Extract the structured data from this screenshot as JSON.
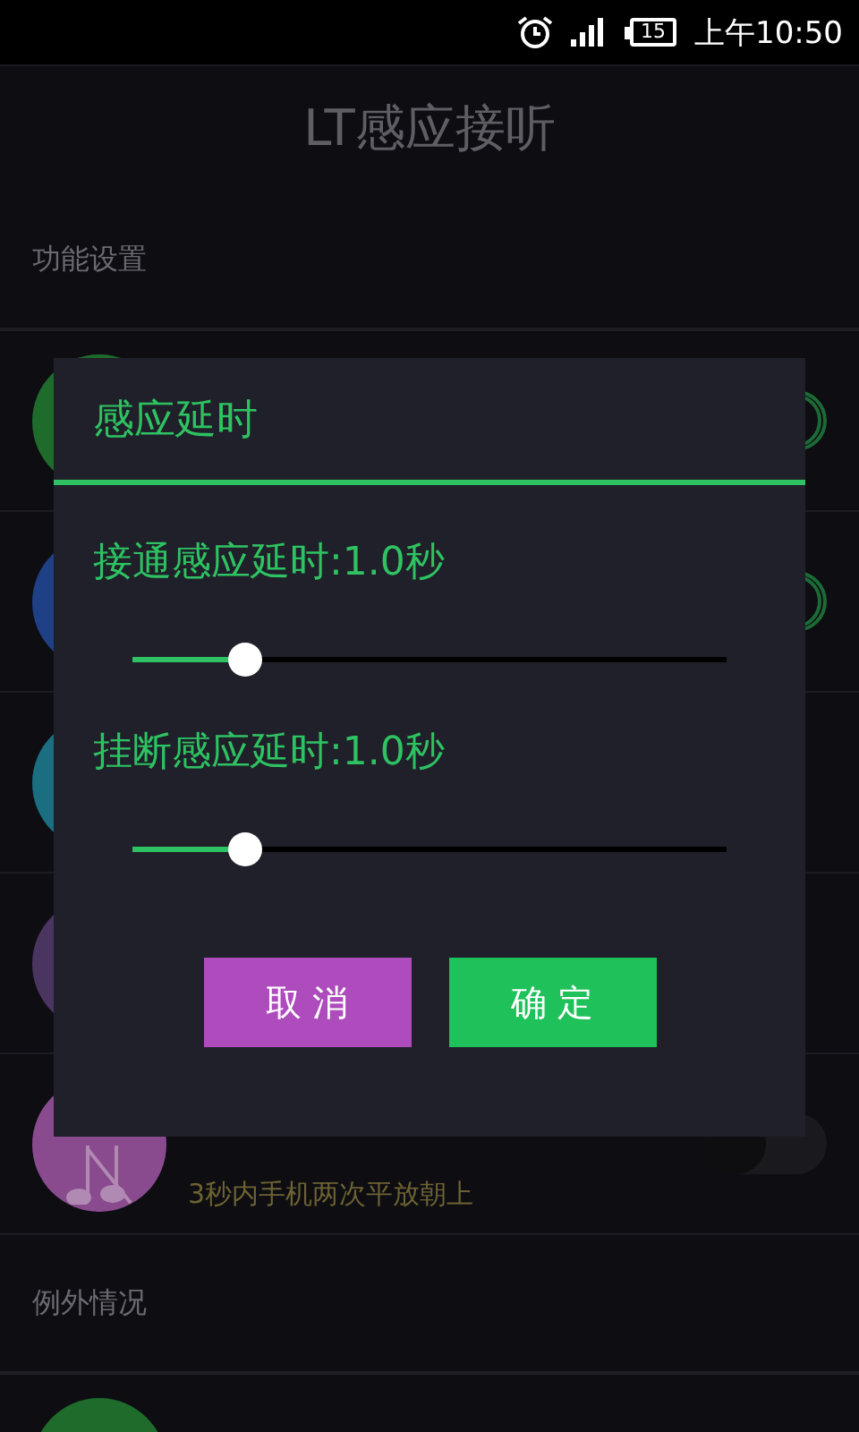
{
  "status_bar": {
    "battery": "15",
    "time": "上午10:50"
  },
  "app_bar": {
    "title": "LT感应接听"
  },
  "sections": [
    {
      "header": "功能设置",
      "rows": [
        {
          "color": "#1e6b2c",
          "on": true
        },
        {
          "color": "#1f3f86",
          "on": true
        },
        {
          "color": "#1a6e80"
        },
        {
          "color": "#4a3560"
        },
        {
          "color": "#8a4a8e",
          "kind": "music",
          "subtitle": "3秒内手机两次平放朝上",
          "on": false
        }
      ]
    },
    {
      "header": "例外情况",
      "rows": [
        {
          "color": "#1e6b2c"
        }
      ]
    }
  ],
  "dialog": {
    "title": "感应延时",
    "sliders": [
      {
        "label": "接通感应延时:1.0秒",
        "level": 0.19
      },
      {
        "label": "挂断感应延时:1.0秒",
        "level": 0.19
      }
    ],
    "buttons": [
      {
        "label": "取 消",
        "kind": "cancel"
      },
      {
        "label": "确 定",
        "kind": "confirm"
      }
    ]
  }
}
